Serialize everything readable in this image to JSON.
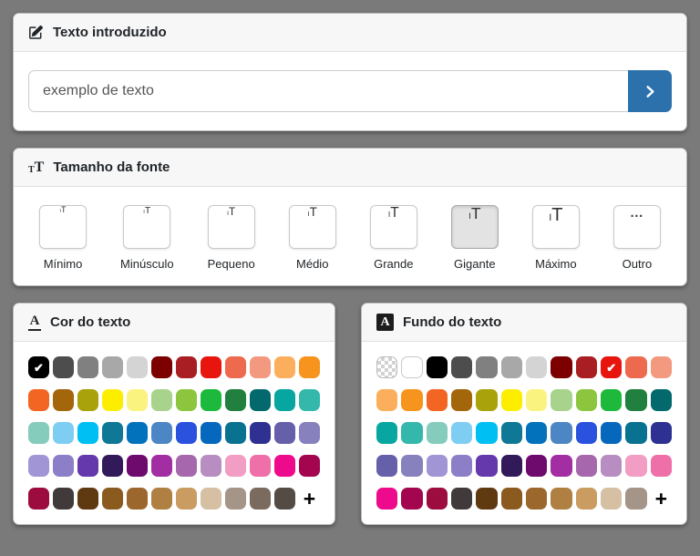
{
  "page": {
    "background": "#7a7a7a",
    "accent_blue": "#2d71ac"
  },
  "icons": {
    "edit": "pencil-square",
    "submit": "chevron-right",
    "check": "✔",
    "size_small_glyph": "I",
    "size_big_glyph": "T",
    "header_t_small": "T",
    "header_t_big": "T",
    "color_letter": "A",
    "background_letter": "A"
  },
  "text_panel": {
    "title": "Texto introduzido",
    "input_value": "exemplo de texto"
  },
  "size_panel": {
    "title": "Tamanho da fonte",
    "other_icon": "…",
    "options": [
      {
        "label": "Mínimo",
        "selected": false
      },
      {
        "label": "Minúsculo",
        "selected": false
      },
      {
        "label": "Pequeno",
        "selected": false
      },
      {
        "label": "Médio",
        "selected": false
      },
      {
        "label": "Grande",
        "selected": false
      },
      {
        "label": "Gigante",
        "selected": true
      },
      {
        "label": "Máximo",
        "selected": false
      },
      {
        "label": "Outro",
        "selected": false
      }
    ]
  },
  "color_panel": {
    "title": "Cor do texto",
    "add_label": "+",
    "selected_index": 0,
    "colors": [
      "#000000",
      "#4d4d4d",
      "#808080",
      "#a8a8a8",
      "#d4d4d4",
      "#7d0000",
      "#a91e22",
      "#e8140e",
      "#ed6a4e",
      "#f3997f",
      "#fbaf5d",
      "#f7941d",
      "#f26522",
      "#a4660b",
      "#a9a20a",
      "#fdee00",
      "#faf380",
      "#a8d38c",
      "#8cc63f",
      "#1db93c",
      "#217f3f",
      "#04696d",
      "#08a6a0",
      "#33b8ab",
      "#85ccbd",
      "#7ecdf2",
      "#00bff3",
      "#0e7896",
      "#0272bc",
      "#4d86c4",
      "#2a52de",
      "#0668bd",
      "#0a7291",
      "#2e3192",
      "#6660aa",
      "#8781bd",
      "#a195d5",
      "#8d7fc7",
      "#6539ac",
      "#321959",
      "#6e096e",
      "#a32da3",
      "#a667ad",
      "#b88ec2",
      "#f29dc3",
      "#ef6fa8",
      "#ee0a8c",
      "#a3064f",
      "#9c0c3f",
      "#413a3a",
      "#5f3a10",
      "#8a5a1f",
      "#9c672c",
      "#b07f42",
      "#ca9c61",
      "#d6c0a4",
      "#a59589",
      "#7b6a5e",
      "#544b45"
    ]
  },
  "background_panel": {
    "title": "Fundo do texto",
    "add_label": "+",
    "selected_index": 9,
    "colors": [
      "transparent",
      "#ffffff",
      "#000000",
      "#4d4d4d",
      "#808080",
      "#a8a8a8",
      "#d4d4d4",
      "#7d0000",
      "#a91e22",
      "#e8140e",
      "#ed6a4e",
      "#f3997f",
      "#fbaf5d",
      "#f7941d",
      "#f26522",
      "#a4660b",
      "#a9a20a",
      "#fdee00",
      "#faf380",
      "#a8d38c",
      "#8cc63f",
      "#1db93c",
      "#217f3f",
      "#04696d",
      "#08a6a0",
      "#33b8ab",
      "#85ccbd",
      "#7ecdf2",
      "#00bff3",
      "#0e7896",
      "#0272bc",
      "#4d86c4",
      "#2a52de",
      "#0668bd",
      "#0a7291",
      "#2e3192",
      "#6660aa",
      "#8781bd",
      "#a195d5",
      "#8d7fc7",
      "#6539ac",
      "#321959",
      "#6e096e",
      "#a32da3",
      "#a667ad",
      "#b88ec2",
      "#f29dc3",
      "#ef6fa8",
      "#ee0a8c",
      "#a3064f",
      "#9c0c3f",
      "#413a3a",
      "#5f3a10",
      "#8a5a1f",
      "#9c672c",
      "#b07f42",
      "#ca9c61",
      "#d6c0a4",
      "#a59589"
    ]
  }
}
